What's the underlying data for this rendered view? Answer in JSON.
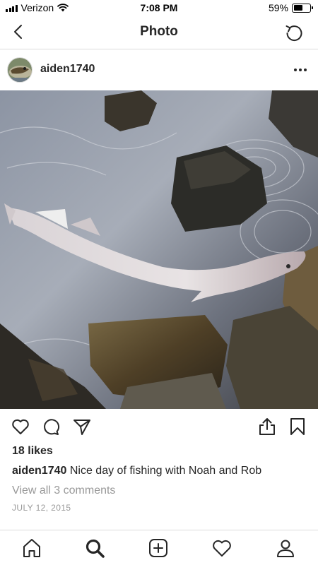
{
  "status_bar": {
    "carrier": "Verizon",
    "time": "7:08 PM",
    "battery_percent": "59%",
    "battery_level": 0.59,
    "icons": [
      "signal-icon",
      "wifi-icon",
      "battery-icon"
    ]
  },
  "nav": {
    "title": "Photo",
    "back_icon": "chevron-left-icon",
    "refresh_icon": "refresh-icon"
  },
  "post": {
    "username": "aiden1740",
    "avatar_icon": "avatar-image",
    "more_icon": "more-horizontal-icon",
    "likes": "18 likes",
    "caption_user": "aiden1740",
    "caption_text": "Nice day of fishing with Noah and Rob",
    "comments_link": "View all 3 comments",
    "date": "JULY 12, 2015"
  },
  "actions": {
    "left": [
      "heart-icon",
      "comment-icon",
      "send-icon"
    ],
    "right": [
      "share-icon",
      "bookmark-icon"
    ]
  },
  "tabbar": {
    "tabs": [
      "home-icon",
      "search-icon",
      "add-post-icon",
      "activity-heart-icon",
      "profile-icon"
    ],
    "active": "search-icon"
  },
  "colors": {
    "text": "#262626",
    "muted": "#999999",
    "divider": "#dbdbdb"
  }
}
